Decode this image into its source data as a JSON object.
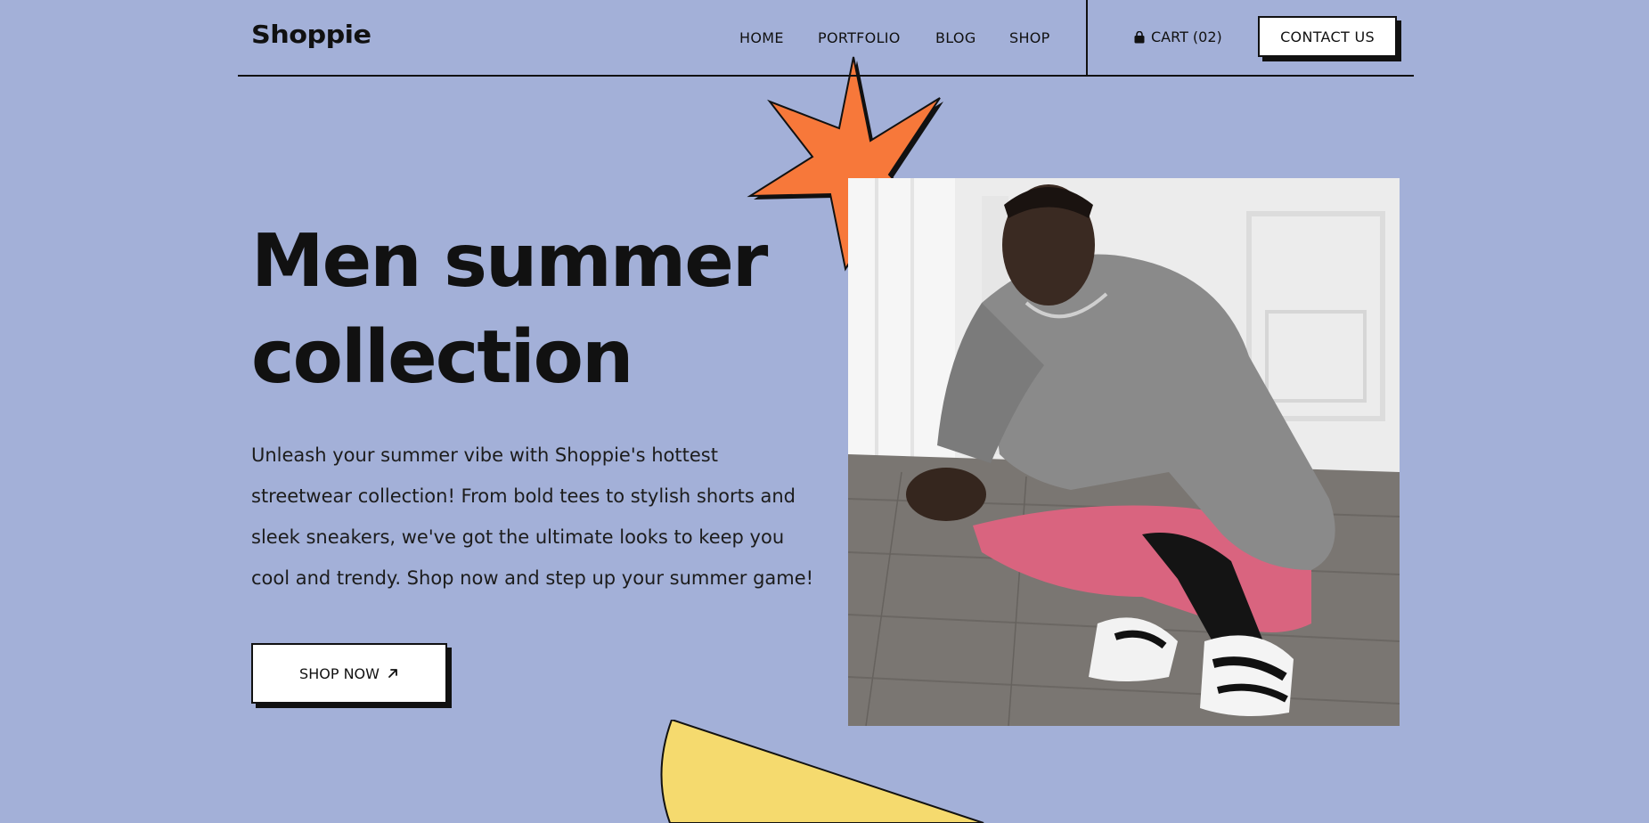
{
  "brand": {
    "name": "Shoppie"
  },
  "nav": {
    "items": [
      "HOME",
      "PORTFOLIO",
      "BLOG",
      "SHOP"
    ]
  },
  "cart": {
    "label": "CART (02)",
    "icon": "shopping-bag-icon"
  },
  "contact_button": {
    "label": "CONTACT US"
  },
  "hero": {
    "title_line1": "Men summer",
    "title_line2": "collection",
    "description": "Unleash your summer vibe with Shoppie's hottest streetwear collection! From bold tees to stylish shorts and sleek sneakers, we've got the ultimate looks to keep you cool and trendy. Shop now and step up your summer game!",
    "cta_label": "SHOP NOW",
    "cta_icon": "arrow-up-right-icon"
  },
  "colors": {
    "background": "#a3b0d8",
    "star": "#f7783a",
    "yellow_shape": "#f5da6e",
    "text": "#111111",
    "button_bg": "#ffffff"
  }
}
